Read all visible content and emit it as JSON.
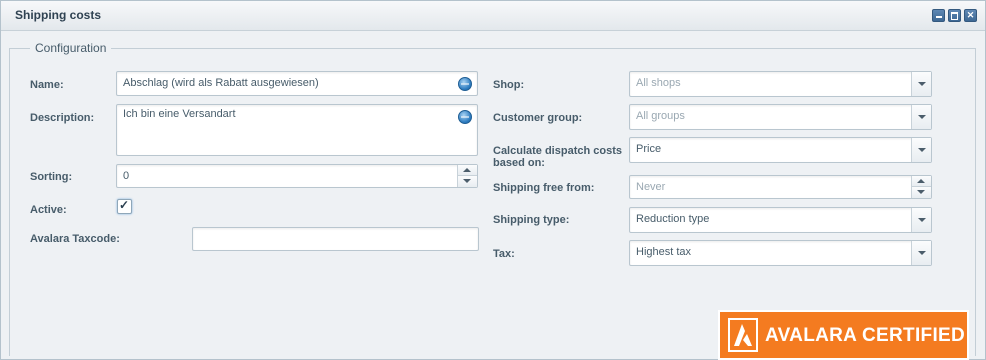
{
  "window": {
    "title": "Shipping costs",
    "buttons": [
      "minimize",
      "maximize",
      "close"
    ]
  },
  "fieldset": {
    "legend": "Configuration"
  },
  "left": {
    "name": {
      "label": "Name:",
      "value": "Abschlag (wird als Rabatt ausgewiesen)"
    },
    "description": {
      "label": "Description:",
      "value": "Ich bin eine Versandart"
    },
    "sorting": {
      "label": "Sorting:",
      "value": "0"
    },
    "active": {
      "label": "Active:",
      "checked": true,
      "check_glyph": "✓"
    },
    "avalara_taxcode": {
      "label": "Avalara Taxcode:",
      "value": ""
    }
  },
  "right": {
    "shop": {
      "label": "Shop:",
      "placeholder": "All shops"
    },
    "customer_group": {
      "label": "Customer group:",
      "placeholder": "All groups"
    },
    "calc_dispatch": {
      "label_line1": "Calculate dispatch costs",
      "label_line2": "based on:",
      "value": "Price"
    },
    "shipping_free_from": {
      "label": "Shipping free from:",
      "placeholder": "Never"
    },
    "shipping_type": {
      "label": "Shipping type:",
      "value": "Reduction type"
    },
    "tax": {
      "label": "Tax:",
      "value": "Highest tax"
    }
  },
  "badge": {
    "text": "AVALARA CERTIFIED"
  },
  "colors": {
    "accent": "#2d7cc0",
    "badge": "#f47b20"
  }
}
